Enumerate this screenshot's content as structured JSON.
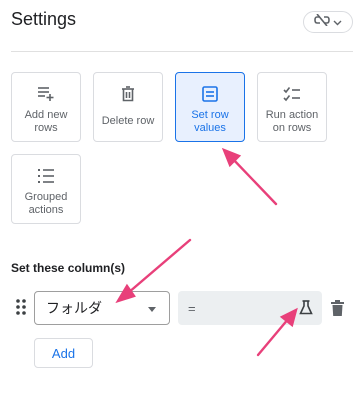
{
  "header": {
    "title": "Settings"
  },
  "actions": [
    {
      "label": "Add new\nrows",
      "icon": "playlist-add-icon"
    },
    {
      "label": "Delete row",
      "icon": "trash-icon"
    },
    {
      "label": "Set row\nvalues",
      "icon": "table-icon",
      "selected": true
    },
    {
      "label": "Run action\non rows",
      "icon": "checklist-icon"
    },
    {
      "label": "Grouped\nactions",
      "icon": "numbered-list-icon"
    }
  ],
  "section": {
    "label": "Set these column(s)"
  },
  "row": {
    "column_value": "フォルダ",
    "operator": "="
  },
  "buttons": {
    "add_label": "Add"
  },
  "colors": {
    "accent": "#1a73e8",
    "annotation": "#e8407a",
    "selected_bg": "#e8f0fe"
  }
}
